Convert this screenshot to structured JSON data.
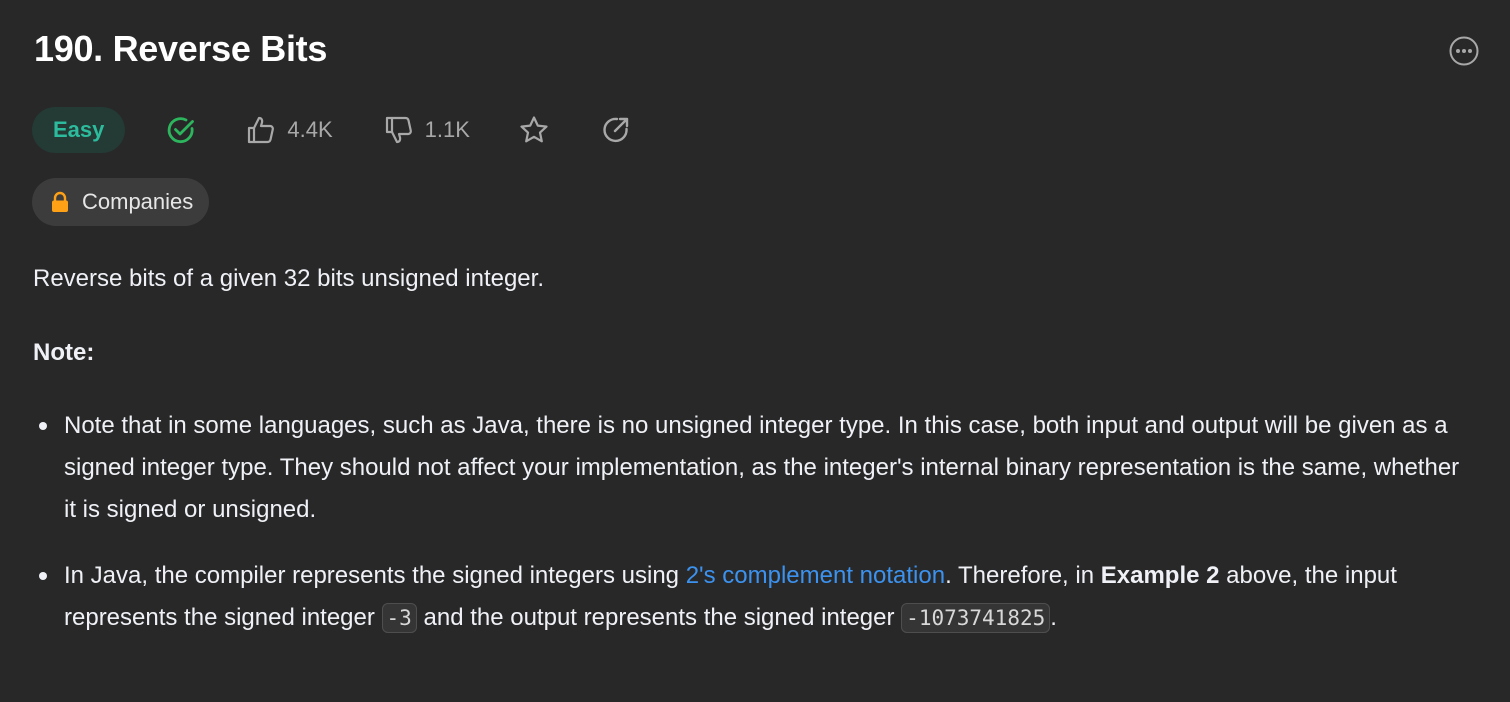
{
  "problem": {
    "title": "190. Reverse Bits",
    "difficulty": "Easy",
    "likes": "4.4K",
    "dislikes": "1.1K"
  },
  "companies": {
    "label": "Companies"
  },
  "description": {
    "intro": "Reverse bits of a given 32 bits unsigned integer.",
    "note_heading": "Note:",
    "note1": "Note that in some languages, such as Java, there is no unsigned integer type. In this case, both input and output will be given as a signed integer type. They should not affect your implementation, as the integer's internal binary representation is the same, whether it is signed or unsigned.",
    "note2_part1": "In Java, the compiler represents the signed integers using ",
    "note2_link": "2's complement notation",
    "note2_part2": ". Therefore, in ",
    "note2_bold": "Example 2",
    "note2_part3": " above, the input represents the signed integer ",
    "note2_code1": "-3",
    "note2_part4": " and the output represents the signed integer ",
    "note2_code2": "-1073741825",
    "note2_part5": "."
  },
  "icons": {
    "more": "more-horizontal-icon",
    "solved": "check-circle-icon",
    "like": "thumbs-up-icon",
    "dislike": "thumbs-down-icon",
    "favorite": "star-icon",
    "share": "share-icon",
    "lock": "lock-icon"
  },
  "colors": {
    "background": "#282828",
    "easy_text": "#2cbb9c",
    "easy_bg": "#233a35",
    "solved_check": "#2db55d",
    "link": "#3c92ef",
    "lock": "#ffa116"
  }
}
